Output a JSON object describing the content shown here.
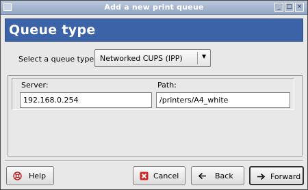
{
  "window": {
    "title": "Add a new print queue"
  },
  "header": {
    "title": "Queue type"
  },
  "queue_type": {
    "label": "Select a queue type:",
    "selected": "Networked CUPS (IPP)"
  },
  "fields": {
    "server": {
      "label": "Server:",
      "value": "192.168.0.254"
    },
    "path": {
      "label": "Path:",
      "value": "/printers/A4_white"
    }
  },
  "buttons": {
    "help": {
      "label": "Help"
    },
    "cancel": {
      "label": "Cancel"
    },
    "back": {
      "label": "Back"
    },
    "forward": {
      "label": "Forward"
    }
  },
  "colors": {
    "header_bg": "#3c63a8",
    "titlebar": "#a4b4cf",
    "cancel_icon": "#d32424"
  },
  "icons": [
    "window-menu-icon",
    "minimize-icon",
    "maximize-icon",
    "close-icon",
    "help-icon",
    "cancel-icon",
    "back-arrow-icon",
    "forward-arrow-icon",
    "dropdown-arrow-icon"
  ]
}
